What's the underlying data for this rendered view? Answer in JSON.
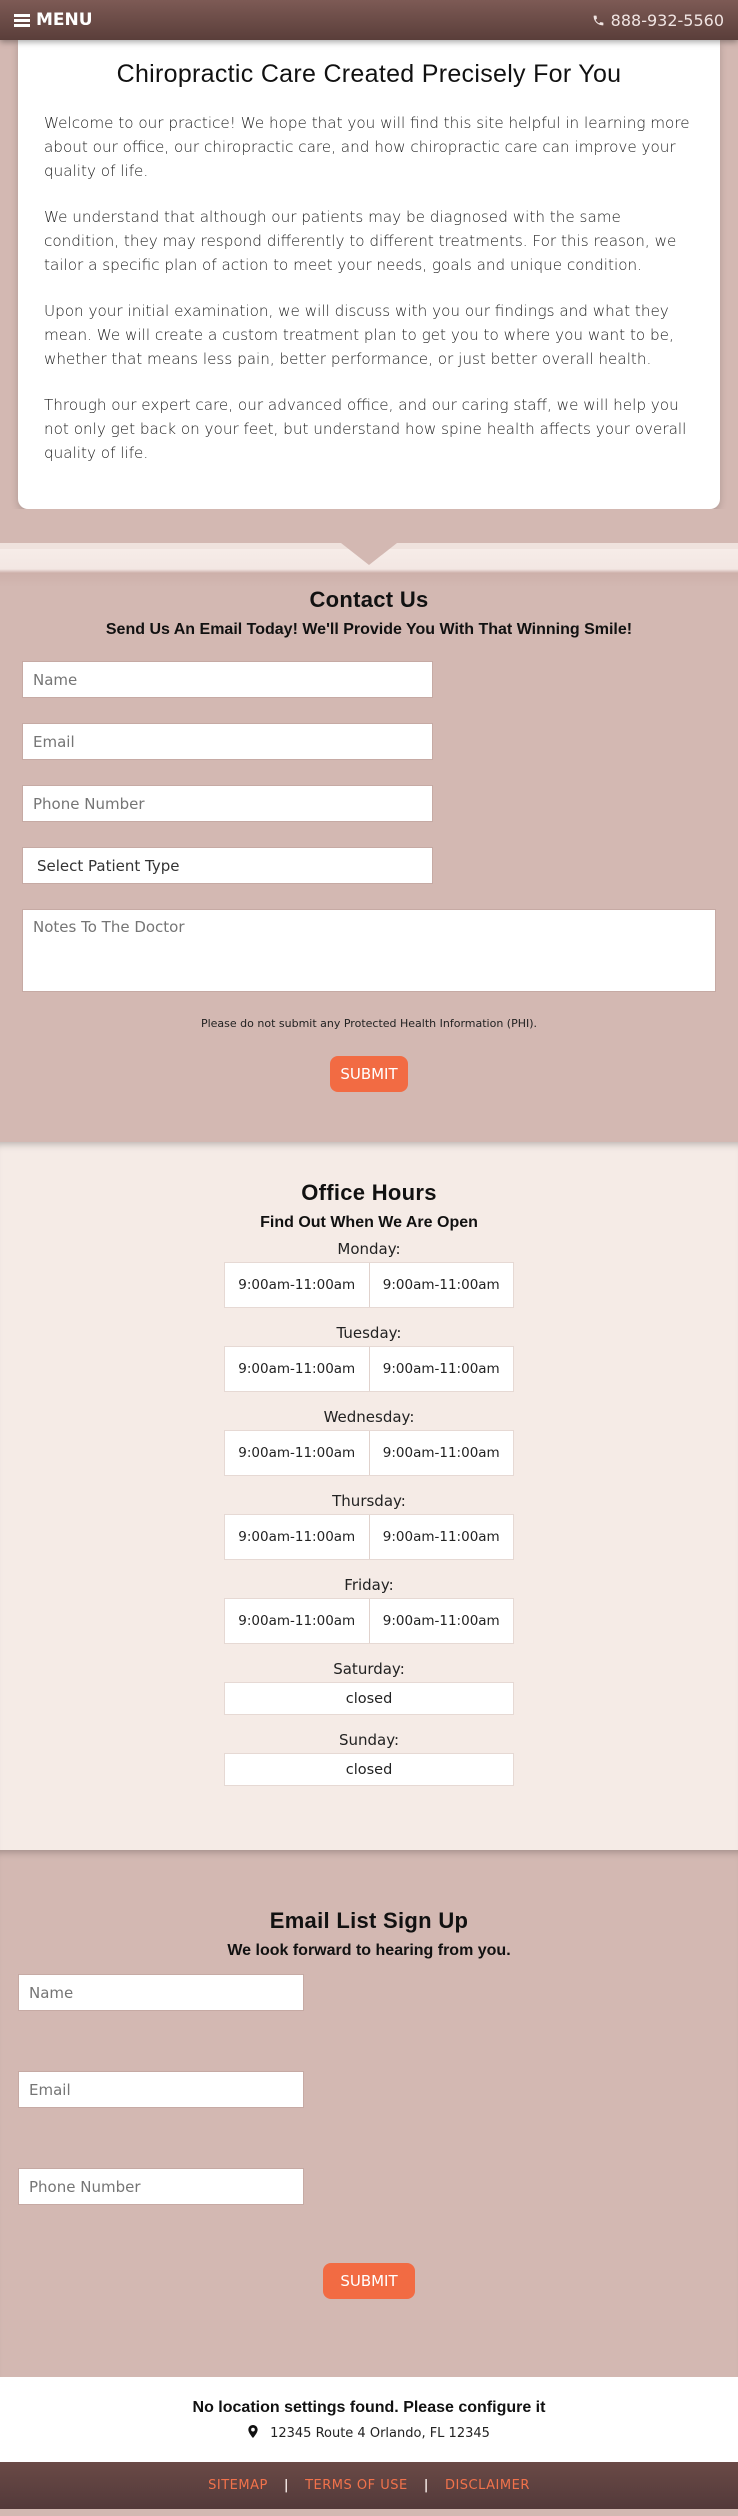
{
  "header": {
    "menu_label": "MENU",
    "menu_icon": "hamburger-icon",
    "phone_icon": "phone-icon",
    "phone": "888-932-5560"
  },
  "intro": {
    "title": "Chiropractic Care Created Precisely For You",
    "paragraphs": [
      "Welcome to our practice! We hope that you will find this site helpful in learning more about our office, our chiropractic care, and how chiropractic care can improve your quality of life.",
      "We understand that although our patients may be diagnosed with the same condition, they may respond differently to different treatments. For this reason, we tailor a specific plan of action to meet your needs, goals and unique condition.",
      "Upon your initial examination, we will discuss with you our findings and what they mean. We will create a custom treatment plan to get you to where you want to be, whether that means less pain, better performance, or just better overall health.",
      "Through our expert care, our advanced office, and our caring staff, we will help you not only get back on your feet, but understand how spine health affects your overall quality of life."
    ]
  },
  "contact": {
    "title": "Contact Us",
    "subtitle": "Send Us An Email Today! We'll Provide You With That Winning Smile!",
    "name_placeholder": "Name",
    "email_placeholder": "Email",
    "phone_placeholder": "Phone Number",
    "patient_type": "Select Patient Type",
    "notes_placeholder": "Notes To The Doctor",
    "phi_note": "Please do not submit any Protected Health Information (PHI).",
    "submit_label": "SUBMIT"
  },
  "hours": {
    "title": "Office Hours",
    "subtitle": "Find Out When We Are Open",
    "days": [
      {
        "day": "Monday:",
        "am": "9:00am-11:00am",
        "pm": "9:00am-11:00am"
      },
      {
        "day": "Tuesday:",
        "am": "9:00am-11:00am",
        "pm": "9:00am-11:00am"
      },
      {
        "day": "Wednesday:",
        "am": "9:00am-11:00am",
        "pm": "9:00am-11:00am"
      },
      {
        "day": "Thursday:",
        "am": "9:00am-11:00am",
        "pm": "9:00am-11:00am"
      },
      {
        "day": "Friday:",
        "am": "9:00am-11:00am",
        "pm": "9:00am-11:00am"
      },
      {
        "day": "Saturday:",
        "closed": "closed"
      },
      {
        "day": "Sunday:",
        "closed": "closed"
      }
    ]
  },
  "signup": {
    "title": "Email List Sign Up",
    "subtitle": "We look forward to hearing from you.",
    "name_placeholder": "Name",
    "email_placeholder": "Email",
    "phone_placeholder": "Phone Number",
    "submit_label": "SUBMIT"
  },
  "location": {
    "warning": "No location settings found. Please configure it",
    "pin_icon": "map-pin-icon",
    "address": "12345 Route 4 Orlando, FL 12345"
  },
  "footer": {
    "links": [
      "SITEMAP",
      "TERMS OF USE",
      "DISCLAIMER"
    ],
    "separator": "|"
  },
  "colors": {
    "accent": "#f26b43",
    "section_bg": "#d3b8b2",
    "hours_bg": "#f5ebe6",
    "header_bg": "#6b4c48"
  }
}
